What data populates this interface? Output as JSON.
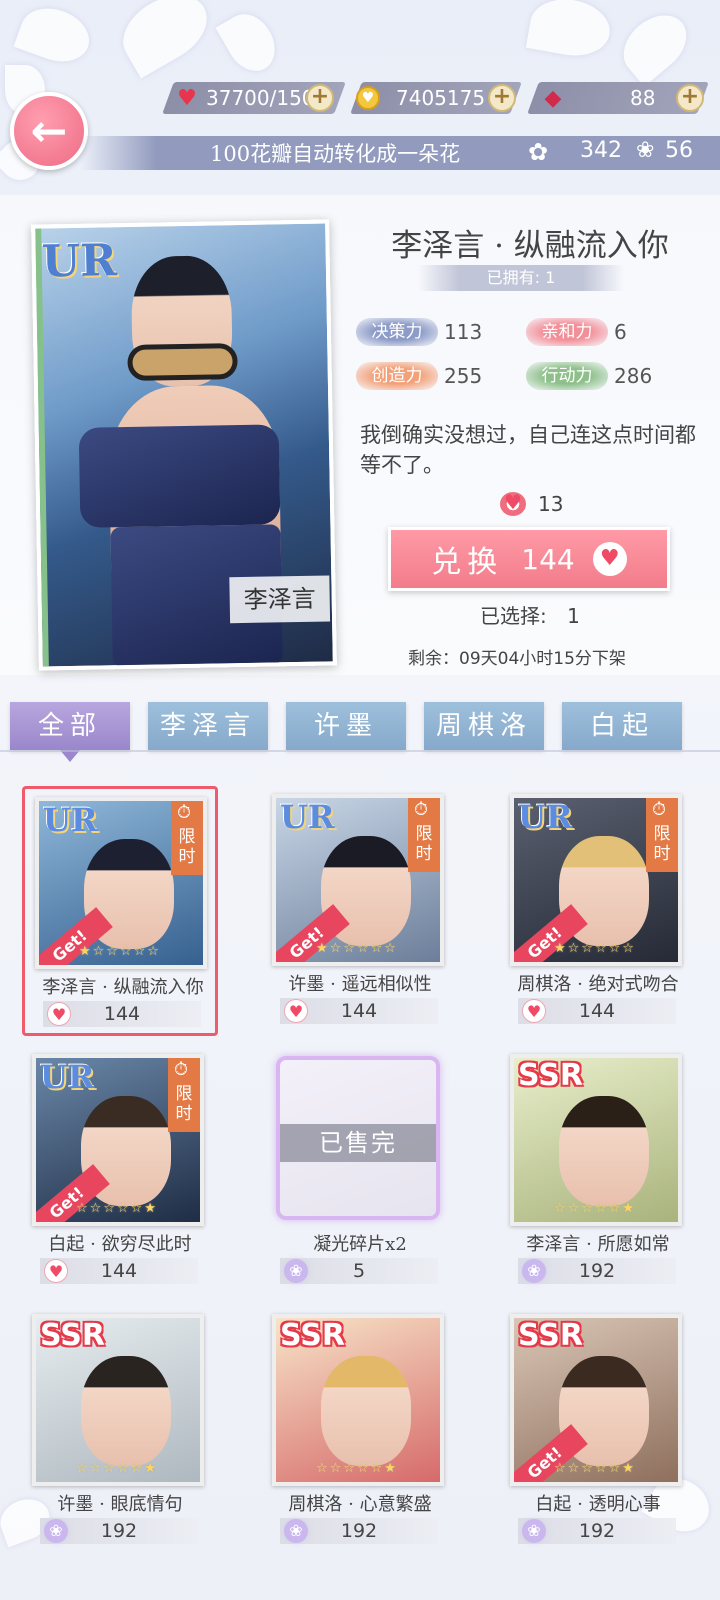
{
  "resources": {
    "stamina": "37700/150",
    "gold": "7405175",
    "diamonds": "88",
    "petal_notice": "100花瓣自动转化成一朵花",
    "flowers": "342",
    "petals": "56"
  },
  "detail": {
    "title": "李泽言 · 纵融流入你",
    "owned": "已拥有: 1",
    "card_name": "李泽言",
    "stats": [
      {
        "label": "决策力",
        "value": "113",
        "color": "#8c9bc7"
      },
      {
        "label": "亲和力",
        "value": "6",
        "color": "#f2909a"
      },
      {
        "label": "创造力",
        "value": "255",
        "color": "#f2a27a"
      },
      {
        "label": "行动力",
        "value": "286",
        "color": "#8fc08c"
      }
    ],
    "quote": "我倒确实没想过，自己连这点时间都等不了。",
    "owned_currency": "13",
    "exchange_label": "兑换",
    "exchange_price": "144",
    "selected_label": "已选择:",
    "selected_count": "1",
    "remaining": "剩余：09天04小时15分下架"
  },
  "tabs": [
    "全部",
    "李泽言",
    "许墨",
    "周棋洛",
    "白起"
  ],
  "items": [
    {
      "name": "李泽言 · 纵融流入你",
      "price": "144",
      "rarity": "UR",
      "limited_label": "限时",
      "get_label": "Get!"
    },
    {
      "name": "许墨 · 遥远相似性",
      "price": "144",
      "rarity": "UR",
      "limited_label": "限时",
      "get_label": "Get!"
    },
    {
      "name": "周棋洛 · 绝对式吻合",
      "price": "144",
      "rarity": "UR",
      "limited_label": "限时",
      "get_label": "Get!"
    },
    {
      "name": "白起 · 欲穷尽此时",
      "price": "144",
      "rarity": "UR",
      "limited_label": "限时",
      "get_label": "Get!"
    },
    {
      "name": "凝光碎片x2",
      "price": "5",
      "soldout_label": "已售完"
    },
    {
      "name": "李泽言 · 所愿如常",
      "price": "192",
      "rarity": "SSR"
    },
    {
      "name": "许墨 · 眼底情句",
      "price": "192",
      "rarity": "SSR"
    },
    {
      "name": "周棋洛 · 心意繁盛",
      "price": "192",
      "rarity": "SSR"
    },
    {
      "name": "白起 · 透明心事",
      "price": "192",
      "rarity": "SSR",
      "get_label": "Get!"
    }
  ],
  "colors": {
    "accent_pink": "#f27c8b",
    "tab_blue": "#86a9cb",
    "tab_active": "#9a87cc"
  }
}
